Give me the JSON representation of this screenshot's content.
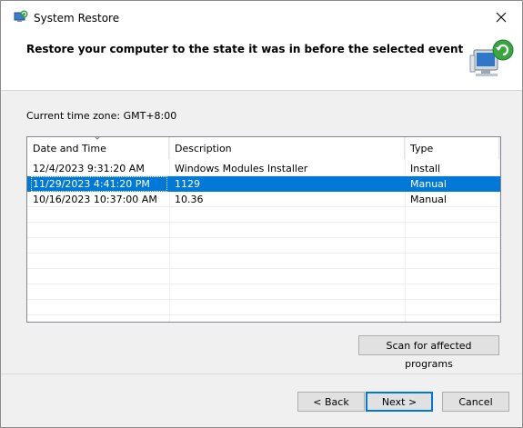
{
  "window": {
    "title": "System Restore"
  },
  "header": {
    "title": "Restore your computer to the state it was in before the selected event"
  },
  "timezone_label": "Current time zone: GMT+8:00",
  "list": {
    "columns": [
      "Date and Time",
      "Description",
      "Type"
    ],
    "sorted_column": "Date and Time",
    "rows": [
      {
        "date": "12/4/2023 9:31:20 AM",
        "description": "Windows Modules Installer",
        "type": "Install",
        "selected": false
      },
      {
        "date": "11/29/2023 4:41:20 PM",
        "description": "1129",
        "type": "Manual",
        "selected": true
      },
      {
        "date": "10/16/2023 10:37:00 AM",
        "description": "10.36",
        "type": "Manual",
        "selected": false
      }
    ]
  },
  "buttons": {
    "scan": "Scan for affected programs",
    "back": "< Back",
    "next": "Next >",
    "cancel": "Cancel"
  },
  "icons": {
    "app": "system-restore-icon",
    "header": "restore-computer-icon",
    "close": "close-icon",
    "sort": "sort-indicator-icon"
  },
  "colors": {
    "selection": "#0078d7",
    "default_button_border": "#0078d7"
  }
}
